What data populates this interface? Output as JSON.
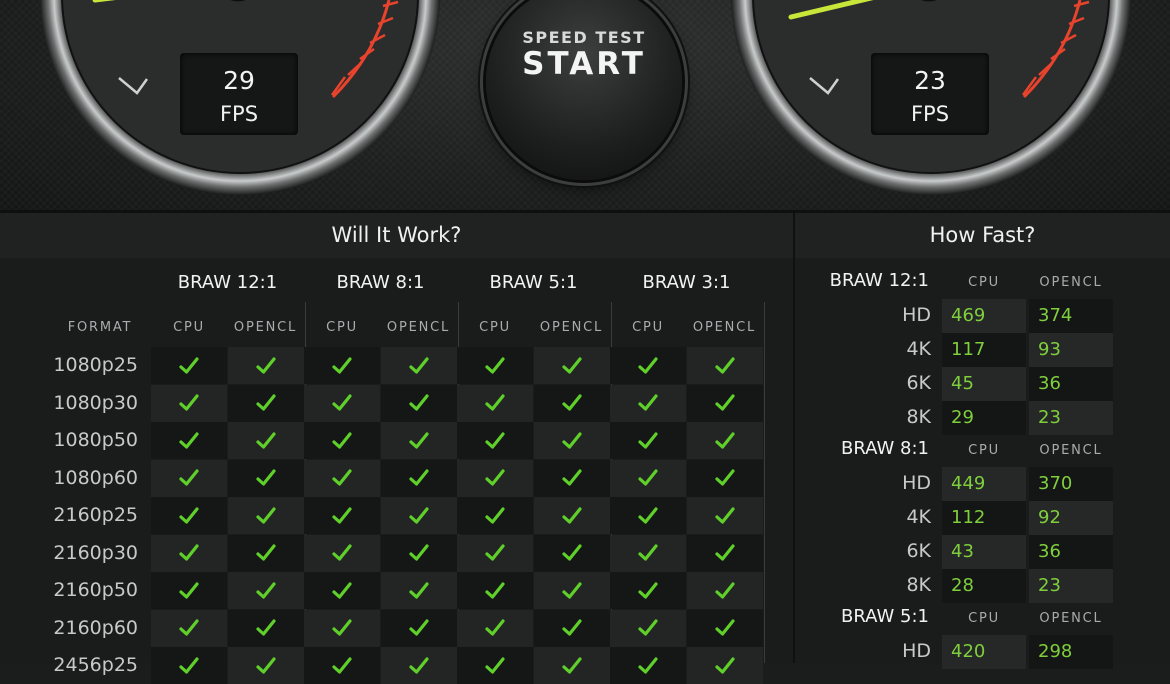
{
  "gauges": {
    "left": {
      "fps_value": "29",
      "fps_unit": "FPS"
    },
    "right": {
      "fps_value": "23",
      "fps_unit": "FPS"
    }
  },
  "start_button": {
    "small_label": "SPEED TEST",
    "big_label": "START"
  },
  "will_it_work": {
    "title": "Will It Work?",
    "format_header": "FORMAT",
    "groups": [
      "BRAW 12:1",
      "BRAW 8:1",
      "BRAW 5:1",
      "BRAW 3:1"
    ],
    "sub_columns": [
      "CPU",
      "OPENCL"
    ],
    "formats": [
      "1080p25",
      "1080p30",
      "1080p50",
      "1080p60",
      "2160p25",
      "2160p30",
      "2160p50",
      "2160p60",
      "2456p25"
    ],
    "check_symbol": "checkmark-icon",
    "check_color": "#5fd02a"
  },
  "how_fast": {
    "title": "How Fast?",
    "col_headers": [
      "CPU",
      "OPENCL"
    ],
    "value_color": "#7fcf3d",
    "groups": [
      {
        "name": "BRAW 12:1",
        "rows": [
          {
            "res": "HD",
            "cpu": "469",
            "opencl": "374"
          },
          {
            "res": "4K",
            "cpu": "117",
            "opencl": "93"
          },
          {
            "res": "6K",
            "cpu": "45",
            "opencl": "36"
          },
          {
            "res": "8K",
            "cpu": "29",
            "opencl": "23"
          }
        ]
      },
      {
        "name": "BRAW 8:1",
        "rows": [
          {
            "res": "HD",
            "cpu": "449",
            "opencl": "370"
          },
          {
            "res": "4K",
            "cpu": "112",
            "opencl": "92"
          },
          {
            "res": "6K",
            "cpu": "43",
            "opencl": "36"
          },
          {
            "res": "8K",
            "cpu": "28",
            "opencl": "23"
          }
        ]
      },
      {
        "name": "BRAW 5:1",
        "rows": [
          {
            "res": "HD",
            "cpu": "420",
            "opencl": "298"
          }
        ]
      }
    ]
  }
}
